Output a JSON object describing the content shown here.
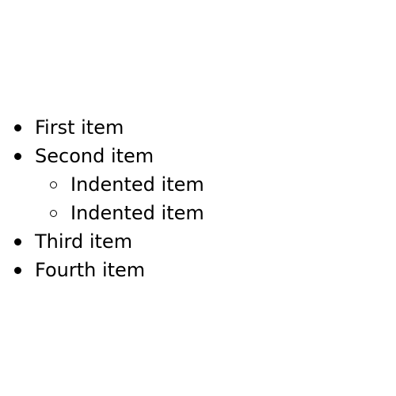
{
  "list": {
    "items": [
      {
        "label": "First item",
        "level": 0,
        "marker": "disc-bullet"
      },
      {
        "label": "Second item",
        "level": 0,
        "marker": "disc-bullet"
      },
      {
        "label": "Indented item",
        "level": 1,
        "marker": "circle-bullet"
      },
      {
        "label": "Indented item",
        "level": 1,
        "marker": "circle-bullet"
      },
      {
        "label": "Third item",
        "level": 0,
        "marker": "disc-bullet"
      },
      {
        "label": "Fourth item",
        "level": 0,
        "marker": "disc-bullet"
      }
    ]
  }
}
